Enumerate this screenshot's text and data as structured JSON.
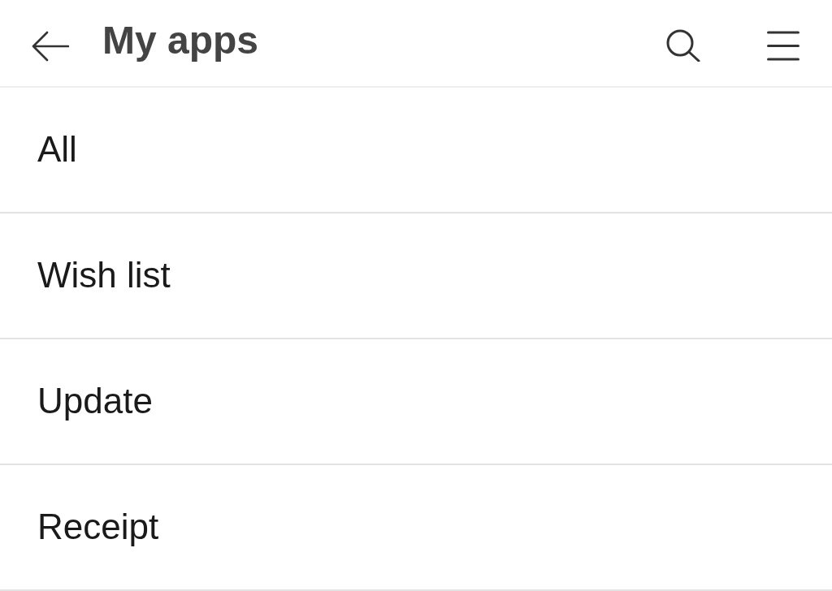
{
  "header": {
    "title": "My apps"
  },
  "menu_items": [
    {
      "label": "All"
    },
    {
      "label": "Wish list"
    },
    {
      "label": "Update"
    },
    {
      "label": "Receipt"
    }
  ]
}
